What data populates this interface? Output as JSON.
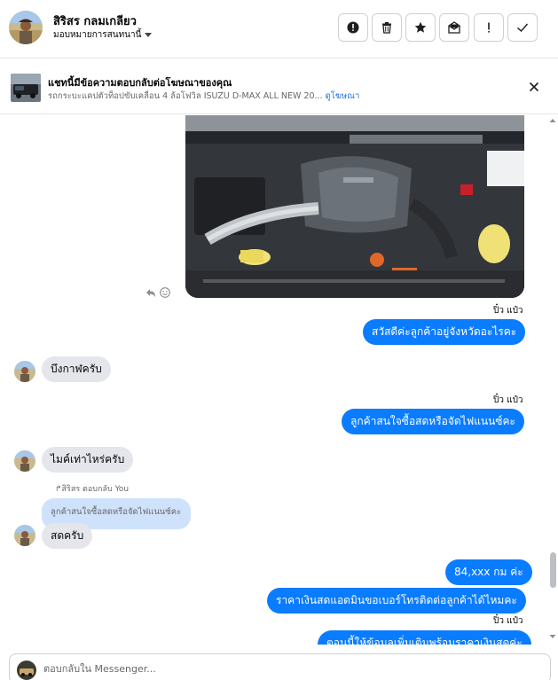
{
  "header": {
    "name": "สิริสร กลมเกลียว",
    "assign_label": "มอบหมายการสนทนานี้",
    "actions": [
      "spam-icon",
      "trash-icon",
      "star-icon",
      "move-icon",
      "exclamation-icon",
      "check-icon"
    ]
  },
  "ad_banner": {
    "title": "แชทนี้มีข้อความตอบกลับต่อโฆษณาของคุณ",
    "subtitle": "รถกระบะแคปตัวท็อปขับเคลื่อน 4 ล้อโฟวิล ISUZU D-MAX ALL NEW 20...",
    "link": "ดูโฆษณา"
  },
  "messages": {
    "seen_1": "ปิ๋ว แป๋ว",
    "out_1": "สวัสดีค่ะลูกค้าอยู่จังหวัดอะไรคะ",
    "in_1": "บึงกาฬครับ",
    "seen_2": "ปิ๋ว แป๋ว",
    "out_2": "ลูกค้าสนใจซื้อสดหรือจัดไฟแนนซ์คะ",
    "in_2": "ไมค์เท่าไหร่ครับ",
    "reply_label": "สิริสร ตอบกลับ You",
    "reply_quote": "ลูกค้าสนใจซื้อสดหรือจัดไฟแนนซ์คะ",
    "in_3": "สดครับ",
    "out_3": "84,xxx กม ค่ะ",
    "out_4": "ราคาเงินสดแอดมินขอเบอร์โทรติดต่อลูกค้าได้ไหมคะ",
    "seen_3": "ปิ๋ว แป๋ว",
    "out_5": "ตอนนี้ให้ข้อมูลเพิ่มเติมพร้อมราคาเงินสดค่ะ"
  },
  "composer": {
    "placeholder": "ตอบกลับใน Messenger..."
  },
  "colors": {
    "outgoing_bubble": "#0a7cff",
    "incoming_bubble": "#e4e6eb",
    "reply_quote": "#cfe2fb",
    "link": "#216fdb"
  }
}
